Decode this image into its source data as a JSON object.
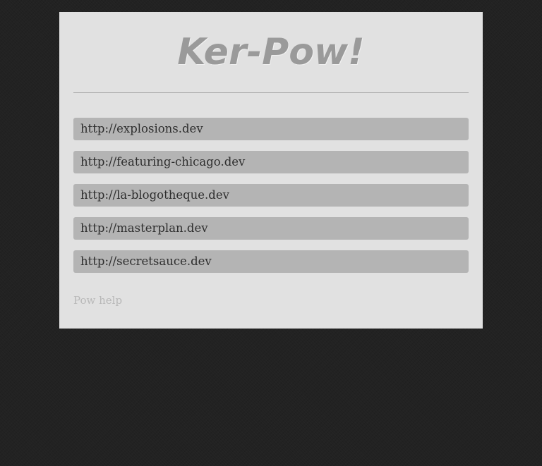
{
  "header": {
    "title": "Ker-Pow!"
  },
  "sites": [
    {
      "label": "http://explosions.dev"
    },
    {
      "label": "http://featuring-chicago.dev"
    },
    {
      "label": "http://la-blogotheque.dev"
    },
    {
      "label": "http://masterplan.dev"
    },
    {
      "label": "http://secretsauce.dev"
    }
  ],
  "footer": {
    "help_label": "Pow help"
  },
  "colors": {
    "page_background": "#222222",
    "panel_background": "#e1e1e1",
    "item_background": "#b4b4b4",
    "title_color": "#9a9a9a",
    "help_link_color": "#b8b8b8"
  }
}
